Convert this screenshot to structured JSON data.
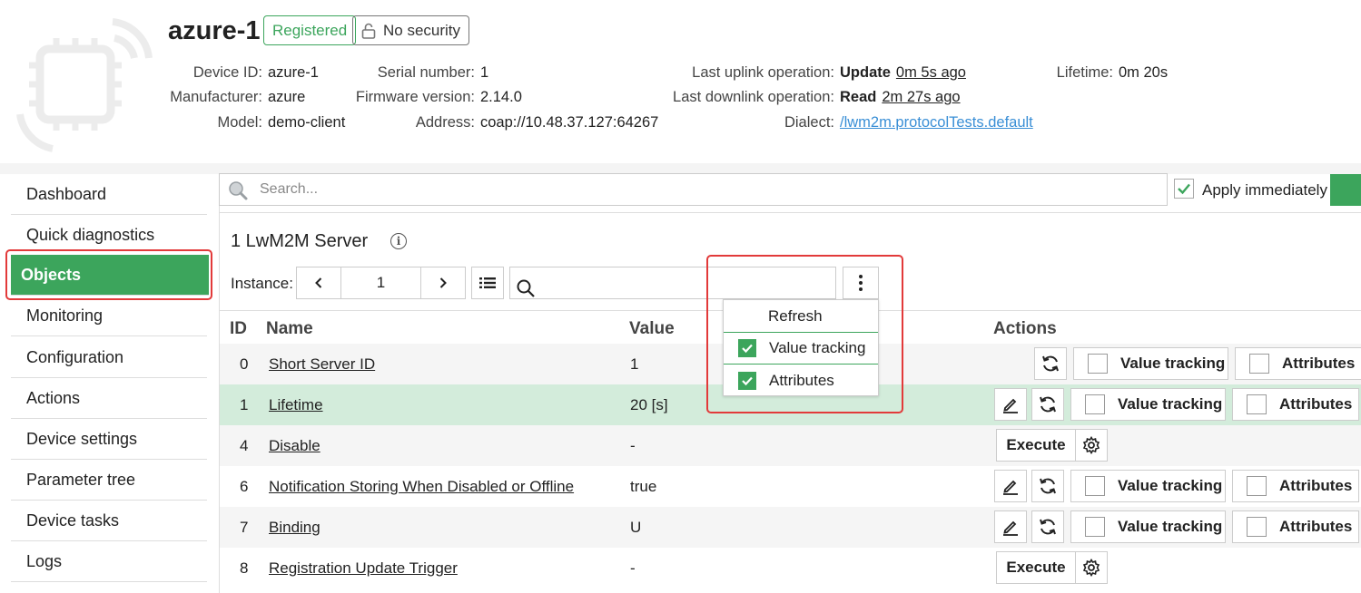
{
  "device": {
    "name": "azure-1",
    "status_badge": "Registered",
    "security_badge": "No security",
    "fields": {
      "device_id_label": "Device ID:",
      "device_id": "azure-1",
      "manufacturer_label": "Manufacturer:",
      "manufacturer": "azure",
      "model_label": "Model:",
      "model": "demo-client",
      "serial_label": "Serial number:",
      "serial": "1",
      "firmware_label": "Firmware version:",
      "firmware": "2.14.0",
      "address_label": "Address:",
      "address": "coap://10.48.37.127:64267",
      "uplink_label": "Last uplink operation:",
      "uplink_op": "Update",
      "uplink_time": "0m 5s ago",
      "downlink_label": "Last downlink operation:",
      "downlink_op": "Read",
      "downlink_time": "2m 27s ago",
      "dialect_label": "Dialect:",
      "dialect": "/lwm2m.protocolTests.default",
      "lifetime_label": "Lifetime:",
      "lifetime": "0m 20s"
    }
  },
  "sidebar": {
    "items": [
      {
        "label": "Dashboard"
      },
      {
        "label": "Quick diagnostics"
      },
      {
        "label": "Objects"
      },
      {
        "label": "Monitoring"
      },
      {
        "label": "Configuration"
      },
      {
        "label": "Actions"
      },
      {
        "label": "Device settings"
      },
      {
        "label": "Parameter tree"
      },
      {
        "label": "Device tasks"
      },
      {
        "label": "Logs"
      }
    ],
    "active": "Objects"
  },
  "search": {
    "placeholder": "Search..."
  },
  "apply": {
    "label": "Apply immediately",
    "checked": true
  },
  "object": {
    "title": "1 LwM2M Server",
    "instance_label": "Instance:",
    "instance_value": "1"
  },
  "dropdown": {
    "refresh": "Refresh",
    "value_tracking": "Value tracking",
    "attributes": "Attributes"
  },
  "table": {
    "headers": {
      "id": "ID",
      "name": "Name",
      "value": "Value",
      "actions": "Actions"
    },
    "action_labels": {
      "value_tracking": "Value tracking",
      "attributes": "Attributes",
      "execute": "Execute"
    },
    "rows": [
      {
        "id": "0",
        "name": "Short Server ID",
        "value": "1"
      },
      {
        "id": "1",
        "name": "Lifetime",
        "value": "20 [s]"
      },
      {
        "id": "4",
        "name": "Disable",
        "value": "-"
      },
      {
        "id": "6",
        "name": "Notification Storing When Disabled or Offline",
        "value": "true"
      },
      {
        "id": "7",
        "name": "Binding",
        "value": "U"
      },
      {
        "id": "8",
        "name": "Registration Update Trigger",
        "value": "-"
      }
    ]
  },
  "colors": {
    "accent": "#3ca55c",
    "highlight": "#e23a3a",
    "link": "#3a8fd6",
    "selected_row": "#d3ecdb"
  }
}
